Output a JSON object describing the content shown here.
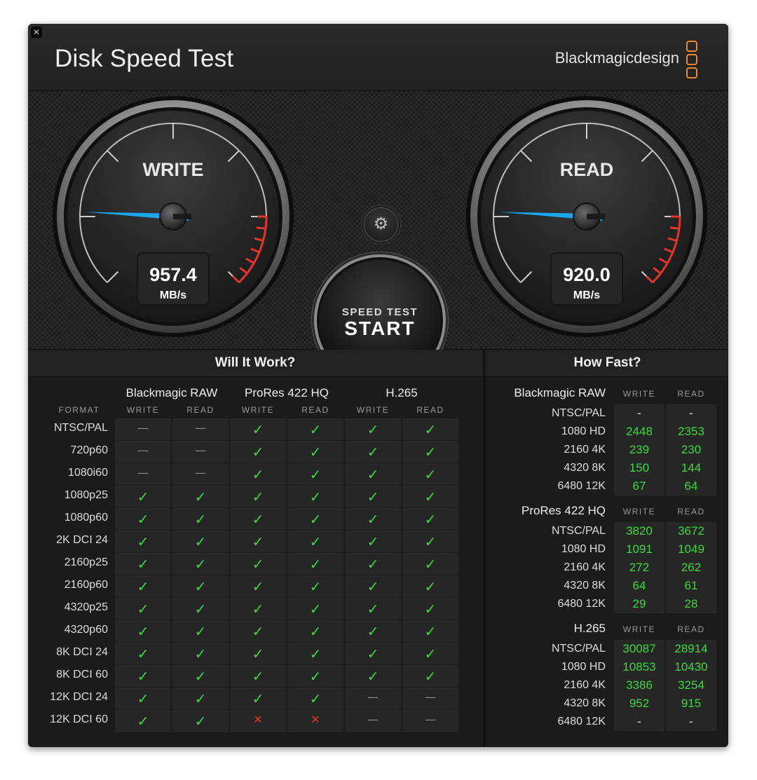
{
  "window": {
    "close_glyph": "✕",
    "title": "Disk Speed Test",
    "brand": "Blackmagicdesign",
    "settings_glyph": "⚙"
  },
  "gauges": {
    "write": {
      "label": "WRITE",
      "value": "957.4",
      "unit": "MB/s"
    },
    "read": {
      "label": "READ",
      "value": "920.0",
      "unit": "MB/s"
    }
  },
  "start_button": {
    "sub": "SPEED TEST",
    "main": "START"
  },
  "will_it_work": {
    "title": "Will It Work?",
    "format_header": "FORMAT",
    "codecs": [
      "Blackmagic RAW",
      "ProRes 422 HQ",
      "H.265"
    ],
    "columns": [
      "WRITE",
      "READ",
      "WRITE",
      "READ",
      "WRITE",
      "READ"
    ],
    "rows": [
      {
        "format": "NTSC/PAL",
        "marks": [
          "dash",
          "dash",
          "check",
          "check",
          "check",
          "check"
        ]
      },
      {
        "format": "720p60",
        "marks": [
          "dash",
          "dash",
          "check",
          "check",
          "check",
          "check"
        ]
      },
      {
        "format": "1080i60",
        "marks": [
          "dash",
          "dash",
          "check",
          "check",
          "check",
          "check"
        ]
      },
      {
        "format": "1080p25",
        "marks": [
          "check",
          "check",
          "check",
          "check",
          "check",
          "check"
        ]
      },
      {
        "format": "1080p60",
        "marks": [
          "check",
          "check",
          "check",
          "check",
          "check",
          "check"
        ]
      },
      {
        "format": "2K DCI 24",
        "marks": [
          "check",
          "check",
          "check",
          "check",
          "check",
          "check"
        ]
      },
      {
        "format": "2160p25",
        "marks": [
          "check",
          "check",
          "check",
          "check",
          "check",
          "check"
        ]
      },
      {
        "format": "2160p60",
        "marks": [
          "check",
          "check",
          "check",
          "check",
          "check",
          "check"
        ]
      },
      {
        "format": "4320p25",
        "marks": [
          "check",
          "check",
          "check",
          "check",
          "check",
          "check"
        ]
      },
      {
        "format": "4320p60",
        "marks": [
          "check",
          "check",
          "check",
          "check",
          "check",
          "check"
        ]
      },
      {
        "format": "8K DCI 24",
        "marks": [
          "check",
          "check",
          "check",
          "check",
          "check",
          "check"
        ]
      },
      {
        "format": "8K DCI 60",
        "marks": [
          "check",
          "check",
          "check",
          "check",
          "check",
          "check"
        ]
      },
      {
        "format": "12K DCI 24",
        "marks": [
          "check",
          "check",
          "check",
          "check",
          "dash",
          "dash"
        ]
      },
      {
        "format": "12K DCI 60",
        "marks": [
          "check",
          "check",
          "x",
          "x",
          "dash",
          "dash"
        ]
      }
    ],
    "glyphs": {
      "check": "✓",
      "dash": "—",
      "x": "✕"
    }
  },
  "how_fast": {
    "title": "How Fast?",
    "groups": [
      {
        "codec": "Blackmagic RAW",
        "write_header": "WRITE",
        "read_header": "READ",
        "rows": [
          {
            "label": "NTSC/PAL",
            "write": "-",
            "read": "-"
          },
          {
            "label": "1080 HD",
            "write": "2448",
            "read": "2353"
          },
          {
            "label": "2160 4K",
            "write": "239",
            "read": "230"
          },
          {
            "label": "4320 8K",
            "write": "150",
            "read": "144"
          },
          {
            "label": "6480 12K",
            "write": "67",
            "read": "64"
          }
        ]
      },
      {
        "codec": "ProRes 422 HQ",
        "write_header": "WRITE",
        "read_header": "READ",
        "rows": [
          {
            "label": "NTSC/PAL",
            "write": "3820",
            "read": "3672"
          },
          {
            "label": "1080 HD",
            "write": "1091",
            "read": "1049"
          },
          {
            "label": "2160 4K",
            "write": "272",
            "read": "262"
          },
          {
            "label": "4320 8K",
            "write": "64",
            "read": "61"
          },
          {
            "label": "6480 12K",
            "write": "29",
            "read": "28"
          }
        ]
      },
      {
        "codec": "H.265",
        "write_header": "WRITE",
        "read_header": "READ",
        "rows": [
          {
            "label": "NTSC/PAL",
            "write": "30087",
            "read": "28914"
          },
          {
            "label": "1080 HD",
            "write": "10853",
            "read": "10430"
          },
          {
            "label": "2160 4K",
            "write": "3386",
            "read": "3254"
          },
          {
            "label": "4320 8K",
            "write": "952",
            "read": "915"
          },
          {
            "label": "6480 12K",
            "write": "-",
            "read": "-"
          }
        ]
      }
    ]
  },
  "colors": {
    "check": "#3ed83e",
    "x": "#e0362c",
    "needle": "#1aa7f0",
    "redzone": "#e0362c",
    "brand_logo": "#e8892b"
  }
}
